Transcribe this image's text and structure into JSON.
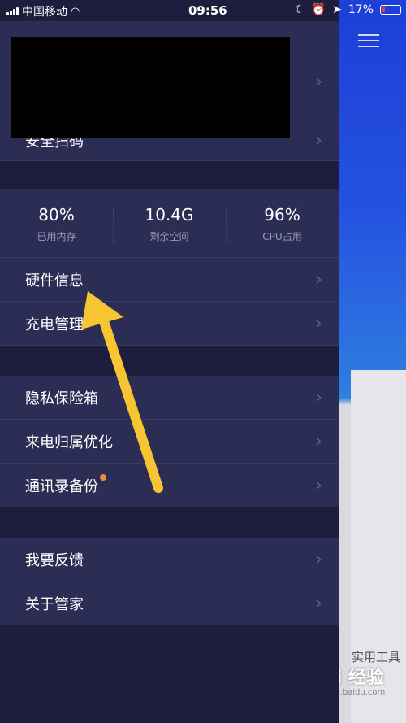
{
  "status_bar": {
    "carrier": "中国移动",
    "time": "09:56",
    "battery": "17%"
  },
  "drawer": {
    "profile_row_label": "安全扫码",
    "stats": [
      {
        "value": "80%",
        "label": "已用内存"
      },
      {
        "value": "10.4G",
        "label": "剩余空间"
      },
      {
        "value": "96%",
        "label": "CPU占用"
      }
    ],
    "menu": {
      "hardware_info": "硬件信息",
      "charge_management": "充电管理",
      "privacy_vault": "隐私保险箱",
      "caller_id_optimize": "来电归属优化",
      "contacts_backup": "通讯录备份",
      "feedback": "我要反馈",
      "about": "关于管家"
    }
  },
  "background_app": {
    "tools_label": "实用工具",
    "watermark": "Bai 经验",
    "watermark_sub": "jingyan.baidu.com"
  },
  "colors": {
    "drawer_bg": "#1d1e3e",
    "row_bg": "#2c2d55",
    "arrow": "#f7c531",
    "badge_dot": "#f08a45"
  }
}
